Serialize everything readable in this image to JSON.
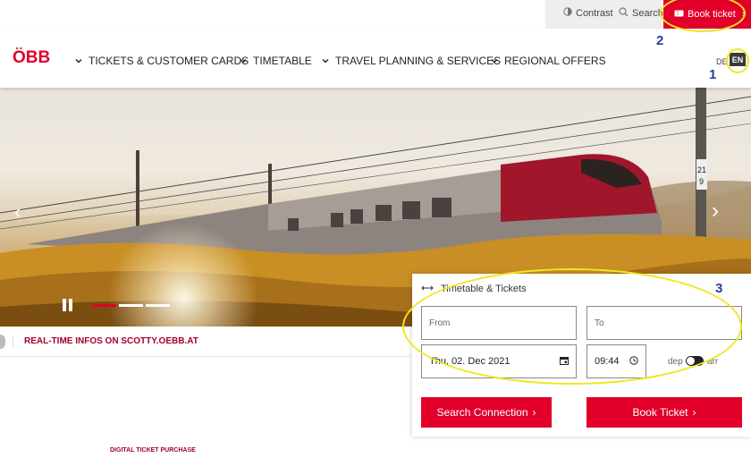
{
  "utility": {
    "contrast_label": "Contrast",
    "search_label": "Search",
    "book_label": "Book ticket"
  },
  "header": {
    "logo_text": "ÖBB",
    "nav": [
      {
        "label": "TICKETS & CUSTOMER CARDS"
      },
      {
        "label": "TIMETABLE"
      },
      {
        "label": "TRAVEL PLANNING & SERVICES"
      },
      {
        "label": "REGIONAL OFFERS"
      }
    ],
    "language": {
      "de": "DE",
      "en": "EN",
      "selected": "EN"
    }
  },
  "hero": {
    "slides_total": 3,
    "active_slide": 1
  },
  "info_strip": {
    "text": "REAL-TIME INFOS ON SCOTTY.OEBB.AT"
  },
  "digital_label": "DIGITAL TICKET PURCHASE",
  "widget": {
    "title": "Timetable & Tickets",
    "from_placeholder": "From",
    "to_placeholder": "To",
    "date_value": "Thu, 02. Dec 2021",
    "time_value": "09:44",
    "dep_label": "dep",
    "arr_label": "arr",
    "search_button": "Search Connection",
    "book_button": "Book Ticket"
  },
  "annotations": {
    "n1": "1",
    "n2": "2",
    "n3": "3"
  },
  "colors": {
    "brand_red": "#e2002a",
    "dark_red": "#a5002a",
    "annotation_yellow": "#f0e620",
    "annotation_blue": "#2a3c9a"
  }
}
